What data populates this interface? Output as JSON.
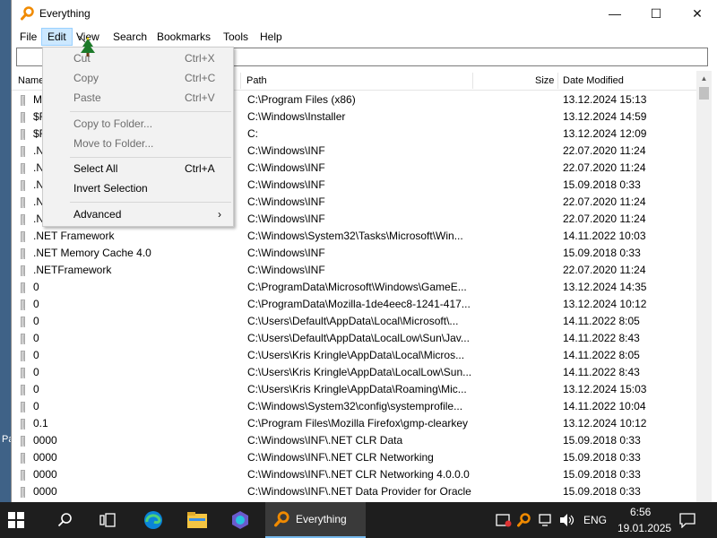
{
  "desktop": {
    "partial_label": "Pa"
  },
  "window": {
    "title": "Everything",
    "menu": [
      "File",
      "Edit",
      "View",
      "Search",
      "Bookmarks",
      "Tools",
      "Help"
    ]
  },
  "search": {
    "value": ""
  },
  "columns": {
    "name": "Name",
    "path": "Path",
    "size": "Size",
    "date": "Date Modified"
  },
  "rows": [
    {
      "name": "M",
      "path": "C:\\Program Files (x86)",
      "date": "13.12.2024 15:13"
    },
    {
      "name": "$R",
      "path": "C:\\Windows\\Installer",
      "date": "13.12.2024 14:59"
    },
    {
      "name": "$R",
      "path": "C:",
      "date": "13.12.2024 12:09"
    },
    {
      "name": ".N",
      "path": "C:\\Windows\\INF",
      "date": "22.07.2020 11:24"
    },
    {
      "name": ".N",
      "path": "C:\\Windows\\INF",
      "date": "22.07.2020 11:24"
    },
    {
      "name": ".N",
      "path": "C:\\Windows\\INF",
      "date": "15.09.2018 0:33"
    },
    {
      "name": ".N",
      "path": "C:\\Windows\\INF",
      "date": "22.07.2020 11:24"
    },
    {
      "name": ".N",
      "path": "C:\\Windows\\INF",
      "date": "22.07.2020 11:24"
    },
    {
      "name": ".NET Framework",
      "path": "C:\\Windows\\System32\\Tasks\\Microsoft\\Win...",
      "date": "14.11.2022 10:03"
    },
    {
      "name": ".NET Memory Cache 4.0",
      "path": "C:\\Windows\\INF",
      "date": "15.09.2018 0:33"
    },
    {
      "name": ".NETFramework",
      "path": "C:\\Windows\\INF",
      "date": "22.07.2020 11:24"
    },
    {
      "name": "0",
      "path": "C:\\ProgramData\\Microsoft\\Windows\\GameE...",
      "date": "13.12.2024 14:35"
    },
    {
      "name": "0",
      "path": "C:\\ProgramData\\Mozilla-1de4eec8-1241-417...",
      "date": "13.12.2024 10:12"
    },
    {
      "name": "0",
      "path": "C:\\Users\\Default\\AppData\\Local\\Microsoft\\...",
      "date": "14.11.2022 8:05"
    },
    {
      "name": "0",
      "path": "C:\\Users\\Default\\AppData\\LocalLow\\Sun\\Jav...",
      "date": "14.11.2022 8:43"
    },
    {
      "name": "0",
      "path": "C:\\Users\\Kris Kringle\\AppData\\Local\\Micros...",
      "date": "14.11.2022 8:05"
    },
    {
      "name": "0",
      "path": "C:\\Users\\Kris Kringle\\AppData\\LocalLow\\Sun...",
      "date": "14.11.2022 8:43"
    },
    {
      "name": "0",
      "path": "C:\\Users\\Kris Kringle\\AppData\\Roaming\\Mic...",
      "date": "13.12.2024 15:03"
    },
    {
      "name": "0",
      "path": "C:\\Windows\\System32\\config\\systemprofile...",
      "date": "14.11.2022 10:04"
    },
    {
      "name": "0.1",
      "path": "C:\\Program Files\\Mozilla Firefox\\gmp-clearkey",
      "date": "13.12.2024 10:12"
    },
    {
      "name": "0000",
      "path": "C:\\Windows\\INF\\.NET CLR Data",
      "date": "15.09.2018 0:33"
    },
    {
      "name": "0000",
      "path": "C:\\Windows\\INF\\.NET CLR Networking",
      "date": "15.09.2018 0:33"
    },
    {
      "name": "0000",
      "path": "C:\\Windows\\INF\\.NET CLR Networking 4.0.0.0",
      "date": "15.09.2018 0:33"
    },
    {
      "name": "0000",
      "path": "C:\\Windows\\INF\\.NET Data Provider for Oracle",
      "date": "15.09.2018 0:33"
    }
  ],
  "edit_menu": {
    "items": [
      {
        "label": "Cut",
        "shortcut": "Ctrl+X",
        "disabled": true
      },
      {
        "label": "Copy",
        "shortcut": "Ctrl+C",
        "disabled": true
      },
      {
        "label": "Paste",
        "shortcut": "Ctrl+V",
        "disabled": true
      },
      {
        "label": "Copy to Folder...",
        "shortcut": "",
        "disabled": true
      },
      {
        "label": "Move to Folder...",
        "shortcut": "",
        "disabled": true
      },
      {
        "label": "Select All",
        "shortcut": "Ctrl+A",
        "disabled": false
      },
      {
        "label": "Invert Selection",
        "shortcut": "",
        "disabled": false
      },
      {
        "label": "Advanced",
        "shortcut": "",
        "disabled": false,
        "submenu": true
      }
    ]
  },
  "taskbar": {
    "active_app": "Everything",
    "language": "ENG",
    "time": "6:56",
    "date": "19.01.2025"
  },
  "colors": {
    "menu_highlight": "#cce8ff",
    "taskbar": "#1e1e1e",
    "app_icon": "#f08a00",
    "desktop": "#3f6287"
  },
  "icons": [
    "everything-app-icon",
    "minimize-icon",
    "maximize-icon",
    "close-icon",
    "folder-icon",
    "windows-start-icon",
    "search-icon",
    "task-view-icon",
    "edge-icon",
    "file-explorer-icon",
    "copilot-icon",
    "volume-icon",
    "network-icon",
    "notification-icon"
  ]
}
